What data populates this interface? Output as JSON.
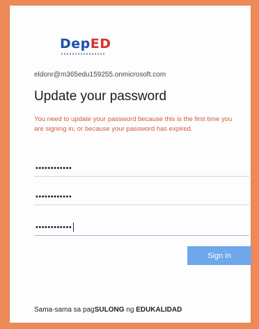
{
  "logo": {
    "part1": "De",
    "part2": "p",
    "part3": "ED"
  },
  "account": {
    "email": "eldonr@m365edu159255.onmicrosoft.com"
  },
  "heading": "Update your password",
  "message": "You need to update your password because this is the first time you are signing in, or because your password has expired.",
  "fields": [
    {
      "value": "••••••••••••"
    },
    {
      "value": "••••••••••••"
    },
    {
      "value": "••••••••••••"
    }
  ],
  "signin_label": "Sign in",
  "footer": {
    "prefix": "Sama-sama sa pag",
    "bold1": "SULONG",
    "middle": " ng ",
    "bold2": "EDUKALIDAD"
  },
  "colors": {
    "background": "#ee8a58",
    "accent": "#6ea8ea",
    "message": "#d25a3c"
  }
}
